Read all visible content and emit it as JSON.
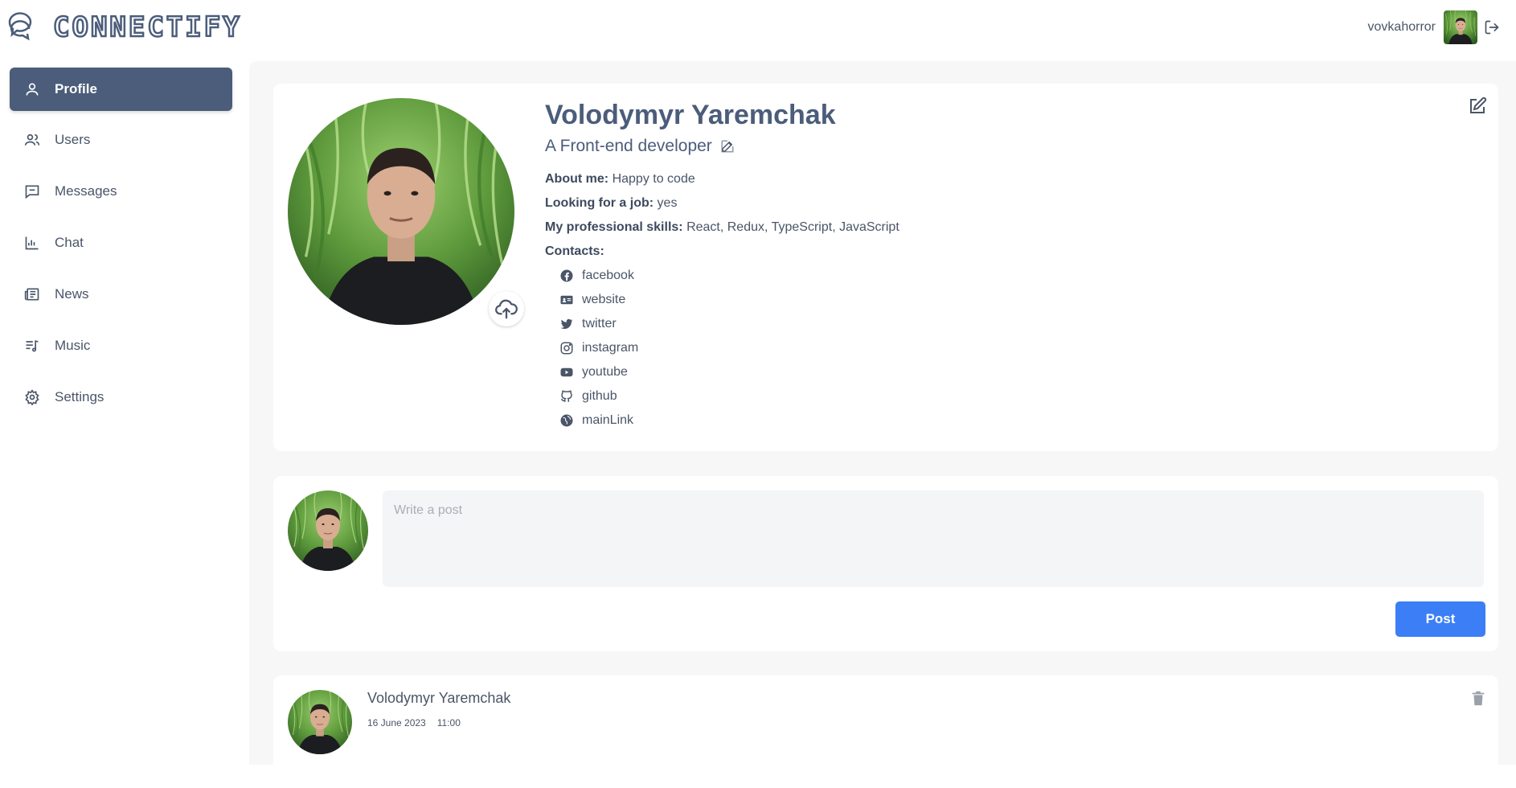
{
  "app": {
    "logo_text": "CONNECTIFY",
    "logo_icon": "chat-bubbles-icon"
  },
  "header": {
    "username": "vovkahorror",
    "logout_icon": "logout-icon"
  },
  "sidebar": {
    "items": [
      {
        "label": "Profile",
        "icon": "user-icon",
        "active": true
      },
      {
        "label": "Users",
        "icon": "users-icon",
        "active": false
      },
      {
        "label": "Messages",
        "icon": "message-icon",
        "active": false
      },
      {
        "label": "Chat",
        "icon": "chart-icon",
        "active": false
      },
      {
        "label": "News",
        "icon": "newspaper-icon",
        "active": false
      },
      {
        "label": "Music",
        "icon": "music-list-icon",
        "active": false
      },
      {
        "label": "Settings",
        "icon": "gear-icon",
        "active": false
      }
    ]
  },
  "profile": {
    "full_name": "Volodymyr Yaremchak",
    "status": "A Front-end developer",
    "about_label": "About me:",
    "about_value": "Happy to code",
    "job_label": "Looking for a job:",
    "job_value": "yes",
    "skills_label": "My professional skills:",
    "skills_value": "React, Redux, TypeScript, JavaScript",
    "contacts_label": "Contacts:",
    "contacts": [
      {
        "label": "facebook",
        "icon": "facebook-icon"
      },
      {
        "label": "website",
        "icon": "id-card-icon"
      },
      {
        "label": "twitter",
        "icon": "twitter-icon"
      },
      {
        "label": "instagram",
        "icon": "instagram-icon"
      },
      {
        "label": "youtube",
        "icon": "youtube-icon"
      },
      {
        "label": "github",
        "icon": "github-icon"
      },
      {
        "label": "mainLink",
        "icon": "globe-icon"
      }
    ]
  },
  "new_post": {
    "placeholder": "Write a post",
    "value": "",
    "button_label": "Post"
  },
  "posts": [
    {
      "author": "Volodymyr Yaremchak",
      "date": "16 June 2023",
      "time": "11:00"
    }
  ],
  "colors": {
    "primary": "#4b5d7a",
    "accent_button": "#3b7ef6",
    "background": "#f7f7f8"
  }
}
